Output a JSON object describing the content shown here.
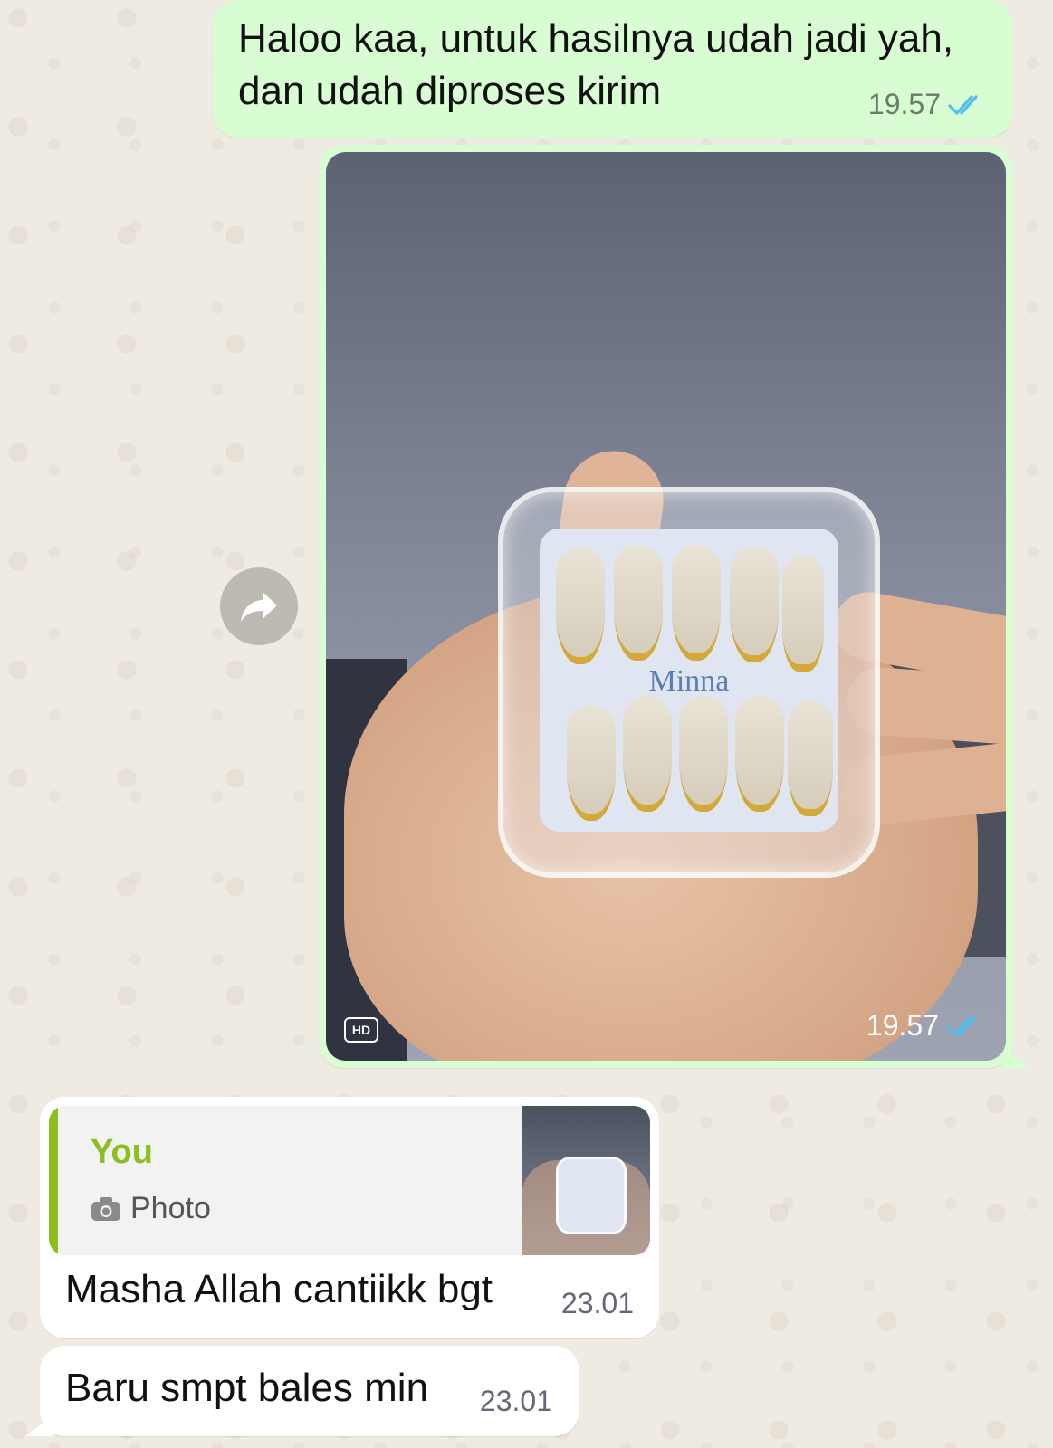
{
  "messages": [
    {
      "id": "msg1",
      "direction": "outgoing",
      "text_line1": "Haloo kaa, untuk hasilnya udah jadi yah,",
      "text_line2": "dan udah diproses kirim",
      "time": "19.57",
      "status_icon": "double-check-read-icon"
    },
    {
      "id": "msg2",
      "direction": "outgoing",
      "type": "photo",
      "badge": "HD",
      "photo_brand_text": "Minna",
      "time": "19.57",
      "status_icon": "double-check-read-icon"
    },
    {
      "id": "msg3",
      "direction": "incoming",
      "quote": {
        "author": "You",
        "type_label": "Photo",
        "type_icon": "camera-icon"
      },
      "text": "Masha Allah cantiikk bgt",
      "time": "23.01"
    },
    {
      "id": "msg4",
      "direction": "incoming",
      "text": "Baru smpt bales min",
      "time": "23.01"
    }
  ],
  "forward_icon": "forward-arrow-icon",
  "colors": {
    "outgoing_bg": "#d9fdd3",
    "incoming_bg": "#ffffff",
    "read_tick": "#53bdeb",
    "quote_accent": "#8bbf1d",
    "chat_bg": "#efeae2"
  }
}
